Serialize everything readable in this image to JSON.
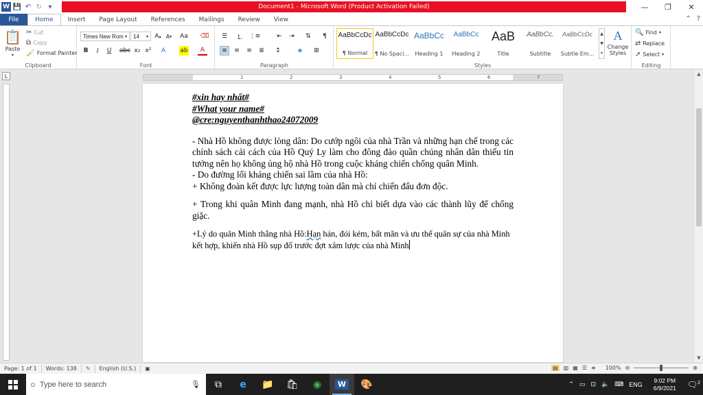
{
  "titlebar": {
    "title": "Document1  -  Microsoft Word (Product Activation Failed)",
    "min": "—",
    "max": "❐",
    "close": "✕"
  },
  "tabs": [
    "File",
    "Home",
    "Insert",
    "Page Layout",
    "References",
    "Mailings",
    "Review",
    "View"
  ],
  "ribbon": {
    "clipboard": {
      "label": "Clipboard",
      "paste": "Paste",
      "cut": "Cut",
      "copy": "Copy",
      "format_painter": "Format Painter"
    },
    "font": {
      "label": "Font",
      "family": "Times New Rom",
      "size": "14"
    },
    "paragraph": {
      "label": "Paragraph"
    },
    "styles": {
      "label": "Styles",
      "items": [
        {
          "preview": "AaBbCcDc",
          "name": "¶ Normal"
        },
        {
          "preview": "AaBbCcDc",
          "name": "¶ No Spaci..."
        },
        {
          "preview": "AaBbCc",
          "name": "Heading 1"
        },
        {
          "preview": "AaBbCc",
          "name": "Heading 2"
        },
        {
          "preview": "AaB",
          "name": "Title"
        },
        {
          "preview": "AaBbCc.",
          "name": "Subtitle"
        },
        {
          "preview": "AaBbCcDc",
          "name": "Subtle Em..."
        }
      ],
      "change_styles": "Change Styles"
    },
    "editing": {
      "label": "Editing",
      "find": "Find",
      "replace": "Replace",
      "select": "Select"
    }
  },
  "ruler": [
    "1",
    "2",
    "3",
    "4",
    "5",
    "6",
    "7"
  ],
  "document": {
    "tag1": "#xin hay nhất#",
    "tag2": "#What your name#",
    "tag3": "@cre:nguyenthanhthao24072009",
    "p1": " - Nhà Hồ không được lòng dân: Do cướp ngôi của nhà Trần và những hạn chế trong các chính sách cải cách của Hồ Quý Ly làm cho đông đảo quần chúng nhân dân thiếu tin tưởng nên họ không ủng hộ nhà Hồ trong cuộc kháng chiến chống quân Minh.",
    "p2": "- Do đường lối kháng chiến sai lầm của nhà Hồ:",
    "p3": "+ Không đoàn kết được lực lượng toàn dân mà chỉ chiến đấu đơn độc.",
    "p4": "+ Trong khi quân Minh đang mạnh, nhà Hồ chỉ biết dựa vào các thành lũy để chống giặc.",
    "p5a": "+Lý do quân Minh thắng nhà Hồ:",
    "p5b": "Hạn",
    "p5c": " hán, đói kém, bất mãn và ưu thế quân sự của nhà Minh kết hợp, khiến nhà Hồ sụp đổ trước đợt xâm lược của nhà Minh"
  },
  "statusbar": {
    "page": "Page: 1 of 1",
    "words": "Words: 138",
    "language": "English (U.S.)",
    "zoom": "100%"
  },
  "taskbar": {
    "search_placeholder": "Type here to search",
    "ime": "ENG",
    "time": "9:02 PM",
    "date": "6/9/2021",
    "notifications": "2"
  }
}
